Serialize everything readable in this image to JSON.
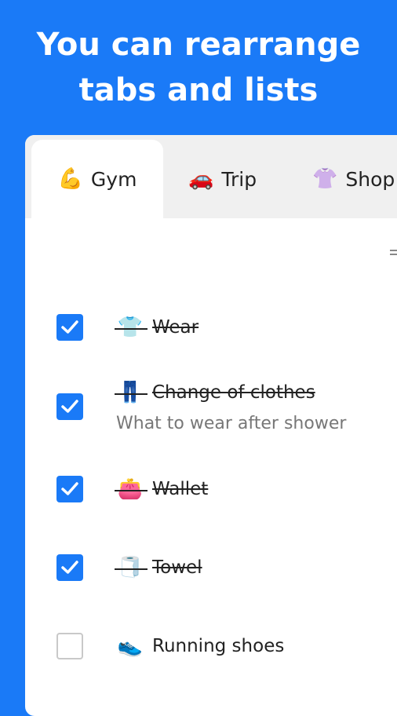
{
  "headline": {
    "line1": "You can rearrange",
    "line2": "tabs and lists"
  },
  "tabs": [
    {
      "label": "Gym",
      "emoji": "💪",
      "active": true
    },
    {
      "label": "Trip",
      "emoji": "🚗",
      "active": false
    },
    {
      "label": "Shop",
      "emoji": "👚",
      "active": false
    }
  ],
  "items": [
    {
      "title": "Wear",
      "emoji": "👕",
      "checked": true,
      "note": ""
    },
    {
      "title": "Change of clothes",
      "emoji": "👖",
      "checked": true,
      "note": "What to wear after shower"
    },
    {
      "title": "Wallet",
      "emoji": "👛",
      "checked": true,
      "note": ""
    },
    {
      "title": "Towel",
      "emoji": "🧻",
      "checked": true,
      "note": ""
    },
    {
      "title": "Running shoes",
      "emoji": "👟",
      "checked": false,
      "note": ""
    }
  ],
  "colors": {
    "accent": "#1a7af7",
    "tabbar": "#f0f0f0",
    "checkbox_border": "#c9c9c9"
  }
}
